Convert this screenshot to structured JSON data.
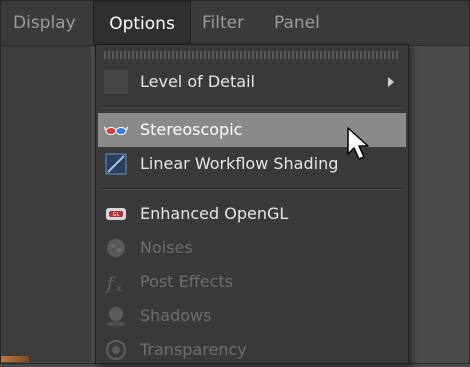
{
  "menubar": {
    "items": [
      {
        "label": "Display"
      },
      {
        "label": "Options"
      },
      {
        "label": "Filter"
      },
      {
        "label": "Panel"
      }
    ]
  },
  "menu": {
    "items": [
      {
        "label": "Level of Detail",
        "icon": "blank-icon",
        "submenu": true
      },
      {
        "label": "Stereoscopic",
        "icon": "stereo-glasses-icon",
        "highlighted": true
      },
      {
        "label": "Linear Workflow Shading",
        "icon": "linear-workflow-icon"
      },
      {
        "label": "Enhanced OpenGL",
        "icon": "enhanced-opengl-icon"
      },
      {
        "label": "Noises",
        "icon": "noise-icon",
        "disabled": true
      },
      {
        "label": "Post Effects",
        "icon": "fx-icon",
        "disabled": true
      },
      {
        "label": "Shadows",
        "icon": "shadow-icon",
        "disabled": true
      },
      {
        "label": "Transparency",
        "icon": "transparency-icon",
        "disabled": true
      }
    ]
  },
  "colors": {
    "menubar_bg": "#3b3b3b",
    "menu_bg": "#3a3a3a",
    "highlight_bg": "#8a8a8a",
    "text": "#e6e6e6",
    "disabled_text": "#6e6e6e"
  }
}
